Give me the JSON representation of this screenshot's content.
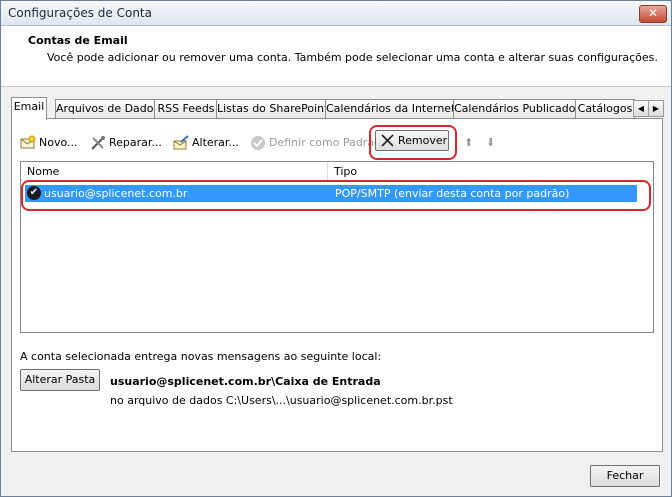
{
  "window": {
    "title": "Configurações de Conta",
    "close_glyph": "✕"
  },
  "header": {
    "title": "Contas de Email",
    "description": "Você pode adicionar ou remover uma conta. Também pode selecionar uma conta e alterar suas configurações."
  },
  "tabs": [
    {
      "label": "Email",
      "active": true
    },
    {
      "label": "Arquivos de Dados"
    },
    {
      "label": "RSS Feeds"
    },
    {
      "label": "Listas do SharePoint"
    },
    {
      "label": "Calendários da Internet"
    },
    {
      "label": "Calendários Publicados"
    },
    {
      "label": "Catálogos"
    }
  ],
  "tab_scroll": {
    "left": "◀",
    "right": "▶"
  },
  "toolbar": {
    "new_label": "Novo...",
    "repair_label": "Reparar...",
    "change_label": "Alterar...",
    "default_label": "Definir como Padrão",
    "remove_label": "Remover",
    "up_glyph": "⬆",
    "down_glyph": "⬇"
  },
  "list": {
    "columns": {
      "name": "Nome",
      "type": "Tipo"
    },
    "rows": [
      {
        "name": "usuario@splicenet.com.br",
        "type": "POP/SMTP (enviar desta conta por padrão)",
        "selected": true,
        "check_glyph": "✔"
      }
    ]
  },
  "delivery": {
    "info": "A conta selecionada entrega novas mensagens ao seguinte local:",
    "change_folder_label": "Alterar Pasta",
    "folder": "usuario@splicenet.com.br\\Caixa de Entrada",
    "datafile": "no arquivo de dados C:\\Users\\...\\usuario@splicenet.com.br.pst"
  },
  "footer": {
    "close_label": "Fechar"
  },
  "colors": {
    "selection": "#3399ff",
    "highlight": "#d12a2a"
  }
}
